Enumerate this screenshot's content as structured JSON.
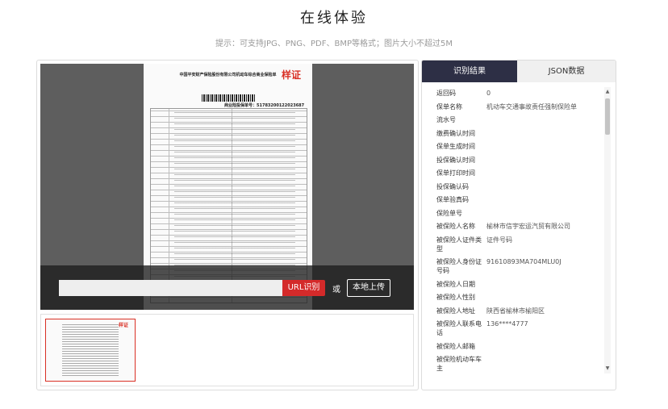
{
  "page": {
    "title": "在线体验",
    "hint": "提示：可支持JPG、PNG、PDF、BMP等格式；图片大小不超过5M"
  },
  "document": {
    "heading": "中国平安财产保险股份有限公司机动车综合商业保险单",
    "stamp": "样证",
    "policy_no": "商业险投保单号：51783200122023687"
  },
  "upload": {
    "url_placeholder": "",
    "url_button": "URL识别",
    "or_text": "或",
    "local_button": "本地上传"
  },
  "thumbnail": {
    "stamp": "样证"
  },
  "tabs": {
    "result": "识别结果",
    "json": "JSON数据"
  },
  "fields": [
    {
      "label": "返回码",
      "value": "0"
    },
    {
      "label": "保单名称",
      "value": "机动车交通事故责任强制保险单"
    },
    {
      "label": "流水号",
      "value": ""
    },
    {
      "label": "缴费确认时间",
      "value": ""
    },
    {
      "label": "保单生成时间",
      "value": ""
    },
    {
      "label": "投保确认时间",
      "value": ""
    },
    {
      "label": "保单打印时间",
      "value": ""
    },
    {
      "label": "投保确认码",
      "value": ""
    },
    {
      "label": "保单验真码",
      "value": ""
    },
    {
      "label": "保险单号",
      "value": ""
    },
    {
      "label": "被保险人名称",
      "value": "榆林市信宇宏运汽贸有限公司"
    },
    {
      "label": "被保险人证件类型",
      "value": "证件号码"
    },
    {
      "label": "被保险人身份证号码",
      "value": "91610893MA704MLU0J"
    },
    {
      "label": "被保险人日期",
      "value": ""
    },
    {
      "label": "被保险人性别",
      "value": ""
    },
    {
      "label": "被保险人地址",
      "value": "陕西省榆林市榆阳区"
    },
    {
      "label": "被保险人联系电话",
      "value": "136****4777"
    },
    {
      "label": "被保险人邮箱",
      "value": ""
    },
    {
      "label": "被保险机动车车主",
      "value": ""
    }
  ]
}
